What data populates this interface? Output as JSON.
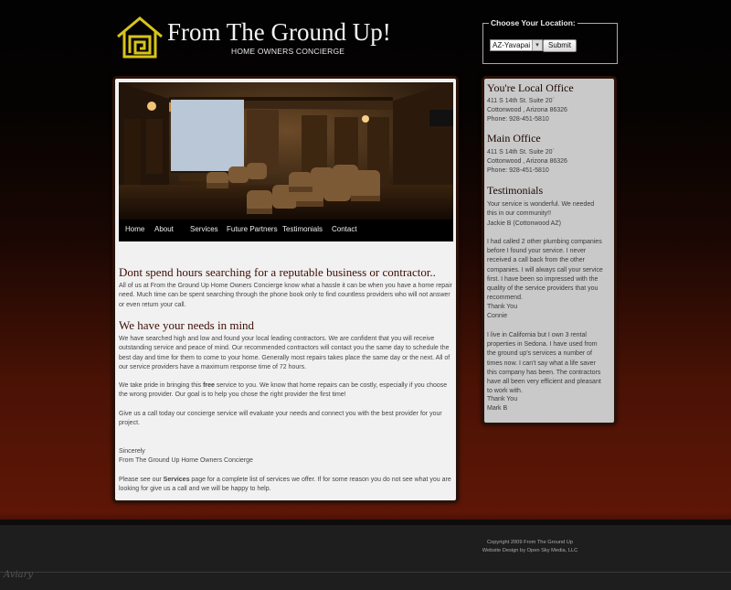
{
  "header": {
    "title": "From The Ground Up!",
    "subtitle": "HOME OWNERS CONCIERGE",
    "logo_icon": "house-maze-logo",
    "logo_color": "#d8c31b"
  },
  "location": {
    "legend": "Choose Your Location:",
    "selected": "AZ-Yavapai",
    "submit_label": "Submit"
  },
  "nav": {
    "items": [
      {
        "label": "Home"
      },
      {
        "label": "About"
      },
      {
        "label": "Services"
      },
      {
        "label": "Future Partners"
      },
      {
        "label": "Testimonials"
      },
      {
        "label": "Contact"
      }
    ]
  },
  "content": {
    "heading1": "Dont spend hours searching for a reputable business or contractor..",
    "para1": "All of us at  From the Ground Up Home Owners Concierge  know what a hassle it can be when you have a home repair need.  Much time can be spent searching through the phone book only to find countless providers who will not answer or even return your call.",
    "heading2": "We have your needs in mind",
    "para2": "We have searched high and low and found your local leading contractors. We are confident that you will receive outstanding service and peace of mind. Our recommended contractors will contact you the same day to schedule the best day and time for them to come to your home.  Generally most repairs takes place the same day or the next. All of our service providers have a maximum response time of 72 hours.",
    "para3_before": "We take pride in bringing this ",
    "para3_bold": "free",
    "para3_after": " service to you. We know that home repairs can be costly, especially if you choose the wrong provider. Our goal is to help you chose the right provider the first time!",
    "para4": "Give us a call today our concierge service will evaluate your needs and connect you with the best provider for your project.",
    "sign1": "Sincerely",
    "sign2": "From The Ground Up Home Owners Concierge",
    "para5_before": "Please see our ",
    "para5_bold": "Services",
    "para5_after": " page for a complete list of services we offer. If for some reason you do not see what you are looking for give us a call and we will be happy to help."
  },
  "sidebar": {
    "local_heading": "You're Local Office",
    "local_addr1": "411 S 14th St. Suite 20`",
    "local_addr2": "Cottonwood , Arizona 86326",
    "local_phone": "Phone: 928-451-5810",
    "main_heading": "Main Office",
    "main_addr1": "411 S 14th St. Suite 20`",
    "main_addr2": "Cottonwood , Arizona 86326",
    "main_phone": "Phone: 928-451-5810",
    "testimonials_heading": "Testimonials",
    "t1": "Your service is wonderful. We needed this in our community!!",
    "t1_author": "Jackie B (Cottonwood AZ)",
    "t2": "I had called 2 other plumbing companies before I found your service. I never received a call back from the other companies. I will always call your service first. I have been so impressed with the quality of the service providers that you recommend.",
    "t2_thanks": "Thank You",
    "t2_author": "Connie",
    "t3": "I live in California but I own 3 rental properties in Sedona. I have used from the ground up's services a number of times now. I can't say what a life saver this company has been. The contractors have all been very efficient and pleasant to work with.",
    "t3_thanks": "Thank You",
    "t3_author": "Mark B"
  },
  "footer": {
    "copyright": "Copyright 2009 From The Ground Up",
    "design": "Website Design by Open Sky Media, LLC"
  },
  "watermark": "Aviary"
}
